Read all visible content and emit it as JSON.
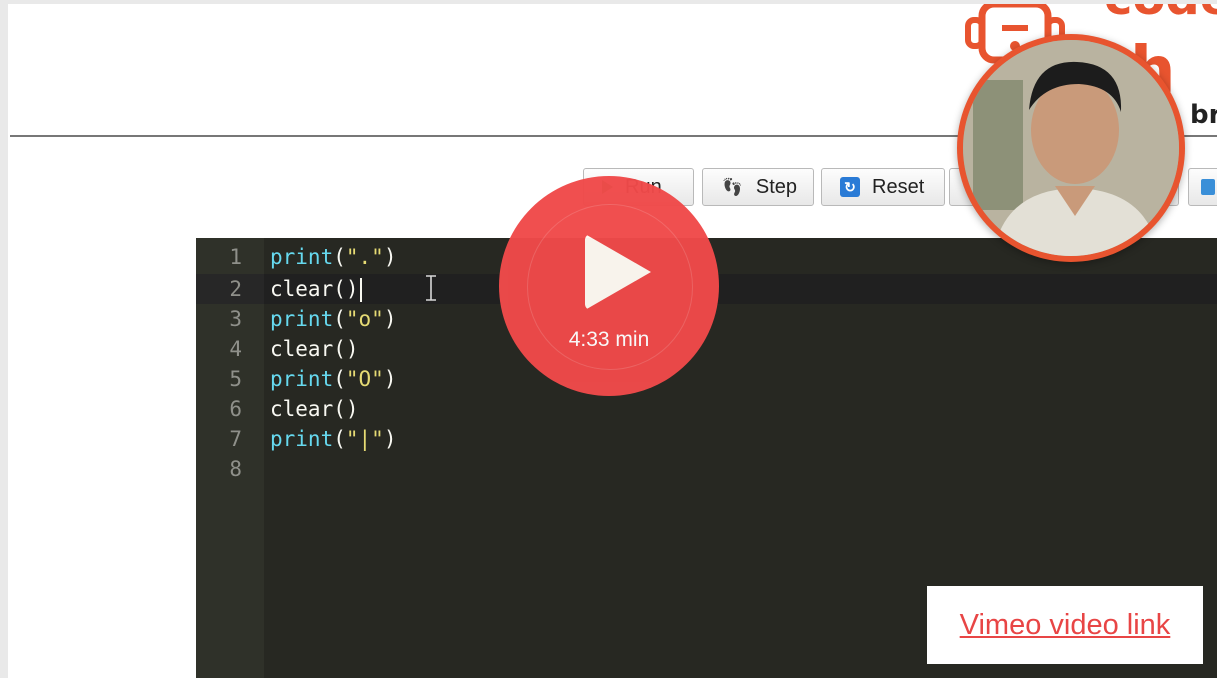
{
  "logo": {
    "line1": "code",
    "line2": "ch",
    "sub": "br"
  },
  "toolbar": {
    "run_label": "Run",
    "step_label": "Step",
    "reset_label": "Reset"
  },
  "editor": {
    "lines": [
      {
        "n": "1",
        "fn": "print",
        "open": "(",
        "str": "\".\"",
        "close": ")"
      },
      {
        "n": "2",
        "text": "clear()"
      },
      {
        "n": "3",
        "fn": "print",
        "open": "(",
        "str": "\"o\"",
        "close": ")"
      },
      {
        "n": "4",
        "text": "clear()"
      },
      {
        "n": "5",
        "fn": "print",
        "open": "(",
        "str": "\"O\"",
        "close": ")"
      },
      {
        "n": "6",
        "text": "clear()"
      },
      {
        "n": "7",
        "fn": "print",
        "open": "(",
        "str": "\"|\"",
        "close": ")"
      },
      {
        "n": "8",
        "text": ""
      }
    ]
  },
  "video": {
    "duration": "4:33 min",
    "link_label": "Vimeo video link"
  },
  "colors": {
    "accent": "#f04a4a",
    "editor_bg": "#272822",
    "string": "#e6db74",
    "keyword": "#66d9ef"
  }
}
